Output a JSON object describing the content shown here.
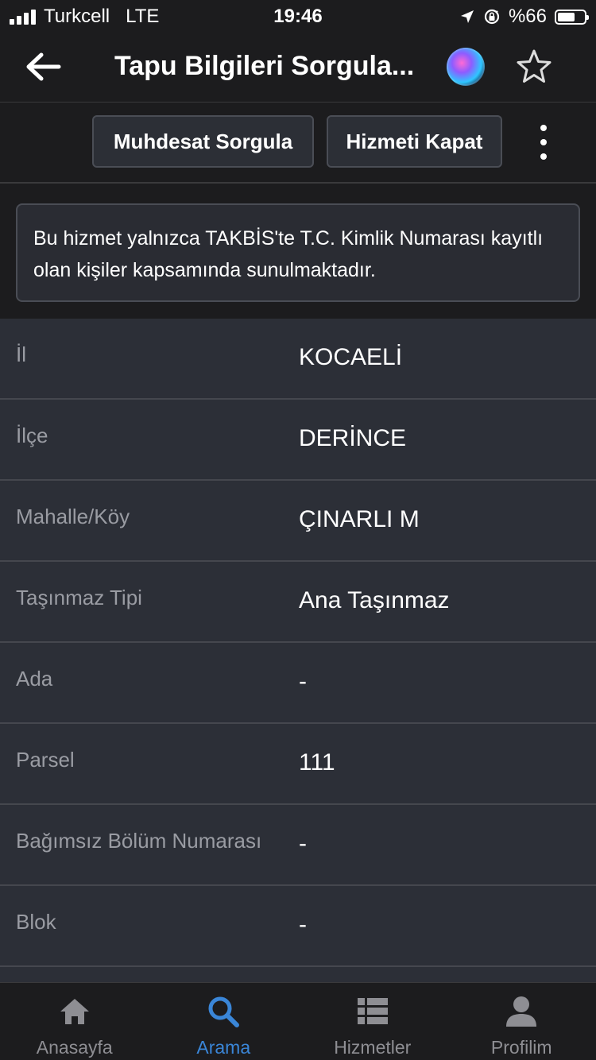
{
  "status_bar": {
    "carrier": "Turkcell",
    "network": "LTE",
    "time": "19:46",
    "battery_text": "%66",
    "battery_level": 0.66
  },
  "nav": {
    "title": "Tapu Bilgileri Sorgula...",
    "back_icon": "arrow-left-icon",
    "siri_icon": "siri-icon",
    "favorite_icon": "star-outline-icon"
  },
  "toolbar": {
    "muhdesat_label": "Muhdesat Sorgula",
    "kapat_label": "Hizmeti Kapat",
    "more_icon": "more-vertical-icon"
  },
  "info": {
    "text": "Bu hizmet yalnızca TAKBİS'te T.C. Kimlik Numarası kayıtlı olan kişiler kapsamında sunulmaktadır."
  },
  "rows": [
    {
      "label": "İl",
      "value": "KOCAELİ"
    },
    {
      "label": "İlçe",
      "value": "DERİNCE"
    },
    {
      "label": "Mahalle/Köy",
      "value": "ÇINARLI M"
    },
    {
      "label": "Taşınmaz Tipi",
      "value": "Ana Taşınmaz"
    },
    {
      "label": "Ada",
      "value": "-"
    },
    {
      "label": "Parsel",
      "value": "111"
    },
    {
      "label": "Bağımsız Bölüm Numarası",
      "value": "-"
    },
    {
      "label": "Blok",
      "value": "-"
    }
  ],
  "tabs": [
    {
      "label": "Anasayfa",
      "icon": "home-icon",
      "active": false
    },
    {
      "label": "Arama",
      "icon": "search-icon",
      "active": true
    },
    {
      "label": "Hizmetler",
      "icon": "list-icon",
      "active": false
    },
    {
      "label": "Profilim",
      "icon": "user-icon",
      "active": false
    }
  ],
  "colors": {
    "background": "#1c1c1e",
    "row_background": "#2c2f37",
    "label_text": "#9a9ca3",
    "active_tab": "#3a86d8",
    "inactive_tab": "#8e8e93"
  }
}
